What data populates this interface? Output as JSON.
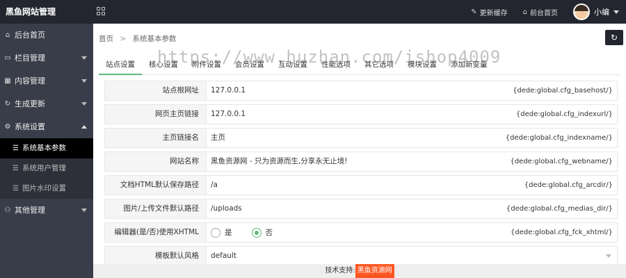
{
  "header": {
    "logo": "黑鱼网站管理",
    "links": [
      {
        "icon": "brush-icon",
        "label": "更新缓存"
      },
      {
        "icon": "home-icon",
        "label": "前台首页"
      }
    ],
    "user_name": "小编"
  },
  "sidebar": {
    "items": [
      {
        "icon": "home-icon",
        "label": "后台首页"
      },
      {
        "icon": "monitor-icon",
        "label": "栏目管理"
      },
      {
        "icon": "grid-icon",
        "label": "内容管理"
      },
      {
        "icon": "refresh-icon",
        "label": "生成更新"
      },
      {
        "icon": "gear-icon",
        "label": "系统设置"
      },
      {
        "icon": "user-icon",
        "label": "其他管理"
      }
    ],
    "submenu": [
      {
        "label": "系统基本参数"
      },
      {
        "label": "系统用户管理"
      },
      {
        "label": "图片水印设置"
      }
    ]
  },
  "breadcrumb": {
    "home": "首页",
    "sep": ">",
    "current": "系统基本参数"
  },
  "tabs": [
    "站点设置",
    "核心设置",
    "附件设置",
    "会员设置",
    "互动设置",
    "性能选项",
    "其它选项",
    "模块设置",
    "添加新变量"
  ],
  "watermark": "https://www.huzhan.com/ishop4009",
  "form_rows": [
    {
      "label": "站点根网址",
      "value": "127.0.0.1",
      "var": "{dede:global.cfg_basehost/}"
    },
    {
      "label": "网页主页链接",
      "value": "127.0.0.1",
      "var": "{dede:global.cfg_indexurl/}"
    },
    {
      "label": "主页链接名",
      "value": "主页",
      "var": "{dede:global.cfg_indexname/}"
    },
    {
      "label": "网站名称",
      "value": "黑鱼资源网 - 只为资源而生,分享永无止境!",
      "var": "{dede:global.cfg_webname/}"
    },
    {
      "label": "文档HTML默认保存路径",
      "value": "/a",
      "var": "{dede:global.cfg_arcdir/}"
    },
    {
      "label": "图片/上传文件默认路径",
      "value": "/uploads",
      "var": "{dede:global.cfg_medias_dir/}"
    }
  ],
  "xhtml_row": {
    "label": "编辑器(是/否)使用XHTML",
    "yes": "是",
    "no": "否",
    "selected": "否",
    "var": "{dede:global.cfg_fck_xhtml/}"
  },
  "style_row": {
    "label": "模板默认风格",
    "value": "default"
  },
  "footer": {
    "prefix": "技术支持:",
    "brand": "黑鱼资源网"
  },
  "colors": {
    "topbar": "#23262e",
    "sidebar": "#393d49",
    "accent_green": "#5fb878",
    "brand_orange": "#ff5722"
  }
}
